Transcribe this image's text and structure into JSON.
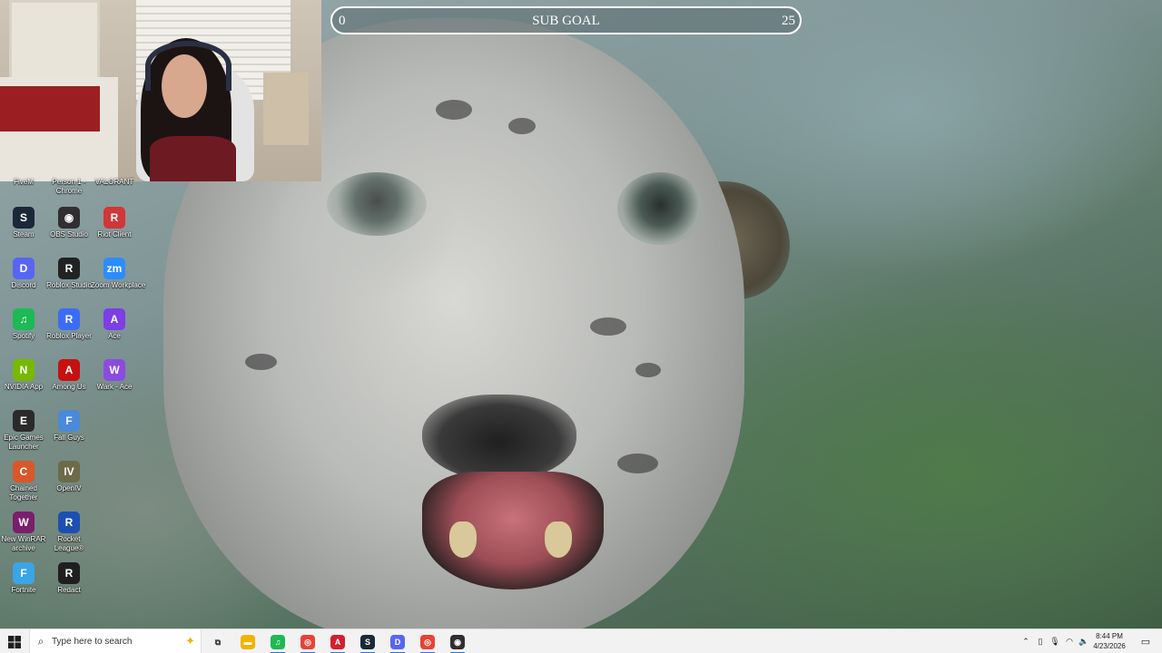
{
  "sub_goal": {
    "start": "0",
    "label": "SUB GOAL",
    "end": "25"
  },
  "desktop": {
    "partial_labels": [
      "FiveM",
      "Person 1 -\nChrome",
      "VALORANT"
    ],
    "icons": [
      {
        "label": "Steam",
        "icon": "steam-icon",
        "color": "#1b2838",
        "glyph": "S"
      },
      {
        "label": "OBS Studio",
        "icon": "obs-icon",
        "color": "#302e31",
        "glyph": "◉"
      },
      {
        "label": "Riot Client",
        "icon": "riot-icon",
        "color": "#d13639",
        "glyph": "R"
      },
      {
        "label": "Discord",
        "icon": "discord-icon",
        "color": "#5865f2",
        "glyph": "D"
      },
      {
        "label": "Roblox Studio",
        "icon": "roblox-studio-icon",
        "color": "#222222",
        "glyph": "R"
      },
      {
        "label": "Zoom Workplace",
        "icon": "zoom-icon",
        "color": "#2d8cff",
        "glyph": "zm"
      },
      {
        "label": "Spotify",
        "icon": "spotify-icon",
        "color": "#1db954",
        "glyph": "♫"
      },
      {
        "label": "Roblox Player",
        "icon": "roblox-player-icon",
        "color": "#3b6cf6",
        "glyph": "R"
      },
      {
        "label": "Ace",
        "icon": "ace-icon",
        "color": "#7b3fe4",
        "glyph": "A"
      },
      {
        "label": "NVIDIA App",
        "icon": "nvidia-icon",
        "color": "#76b900",
        "glyph": "N"
      },
      {
        "label": "Among Us",
        "icon": "among-us-icon",
        "color": "#c51111",
        "glyph": "A"
      },
      {
        "label": "Wark - Ace",
        "icon": "wark-ace-icon",
        "color": "#8a4ce0",
        "glyph": "W"
      },
      {
        "label": "Epic Games\nLauncher",
        "icon": "epic-games-icon",
        "color": "#2a2a2a",
        "glyph": "E"
      },
      {
        "label": "Fall Guys",
        "icon": "fall-guys-icon",
        "color": "#4a8ad8",
        "glyph": "F"
      },
      {
        "label": "",
        "icon": "empty-slot",
        "color": "",
        "glyph": ""
      },
      {
        "label": "Chained\nTogether",
        "icon": "chained-together-icon",
        "color": "#d9572b",
        "glyph": "C"
      },
      {
        "label": "OpenIV",
        "icon": "openiv-icon",
        "color": "#6b6b4a",
        "glyph": "IV"
      },
      {
        "label": "",
        "icon": "empty-slot",
        "color": "",
        "glyph": ""
      },
      {
        "label": "New WinRAR\narchive",
        "icon": "winrar-icon",
        "color": "#7a1e6e",
        "glyph": "W"
      },
      {
        "label": "Rocket\nLeague®",
        "icon": "rocket-league-icon",
        "color": "#1d4fb3",
        "glyph": "R"
      },
      {
        "label": "",
        "icon": "empty-slot",
        "color": "",
        "glyph": ""
      },
      {
        "label": "Fortnite",
        "icon": "fortnite-icon",
        "color": "#3aa5e8",
        "glyph": "F"
      },
      {
        "label": "Redact",
        "icon": "redact-icon",
        "color": "#1f1f1f",
        "glyph": "R"
      }
    ]
  },
  "taskbar": {
    "search_placeholder": "Type here to search",
    "apps": [
      {
        "name": "task-view-icon",
        "glyph": "⧉",
        "color": "#333333"
      },
      {
        "name": "file-explorer-icon",
        "glyph": "▬",
        "color": "#f0b400"
      },
      {
        "name": "spotify-icon",
        "glyph": "♫",
        "color": "#1db954"
      },
      {
        "name": "chrome-icon",
        "glyph": "◎",
        "color": "#e94235"
      },
      {
        "name": "adobe-icon",
        "glyph": "A",
        "color": "#d4202c"
      },
      {
        "name": "steam-icon",
        "glyph": "S",
        "color": "#1b2838"
      },
      {
        "name": "discord-chrome-icon",
        "glyph": "D",
        "color": "#5865f2"
      },
      {
        "name": "chrome-profile-icon",
        "glyph": "◎",
        "color": "#e94235"
      },
      {
        "name": "obs-icon",
        "glyph": "◉",
        "color": "#302e31"
      }
    ],
    "clock": {
      "time": "8:44 PM",
      "date": "4/23/2026"
    }
  }
}
